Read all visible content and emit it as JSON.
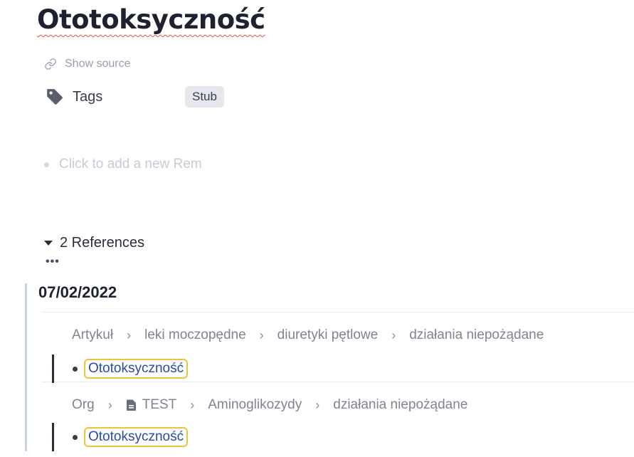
{
  "page": {
    "title": "Ototoksyczność"
  },
  "show_source": {
    "label": "Show source",
    "icon": "link-icon"
  },
  "tags": {
    "label": "Tags",
    "icon": "tag-icon",
    "items": [
      "Stub"
    ]
  },
  "new_rem": {
    "placeholder": "Click to add a new Rem"
  },
  "references": {
    "toggle_label": "2 References",
    "more_label": "•••",
    "date": "07/02/2022",
    "entries": [
      {
        "breadcrumb": [
          "Artykuł",
          "leki moczopędne",
          "diuretyki pętlowe",
          "działania niepożądane"
        ],
        "rem": "Ototoksyczność"
      },
      {
        "breadcrumb": [
          "Org",
          "TEST",
          "Aminoglikozydy",
          "działania niepożądane"
        ],
        "breadcrumb_doc_icon_index": 1,
        "rem": "Ototoksyczność"
      }
    ],
    "separator": "›"
  },
  "colors": {
    "link": "#2b48a8",
    "highlight_border": "#f0c43a",
    "spellcheck_underline": "#e0504f",
    "reference_bar": "#c7d2e6"
  }
}
